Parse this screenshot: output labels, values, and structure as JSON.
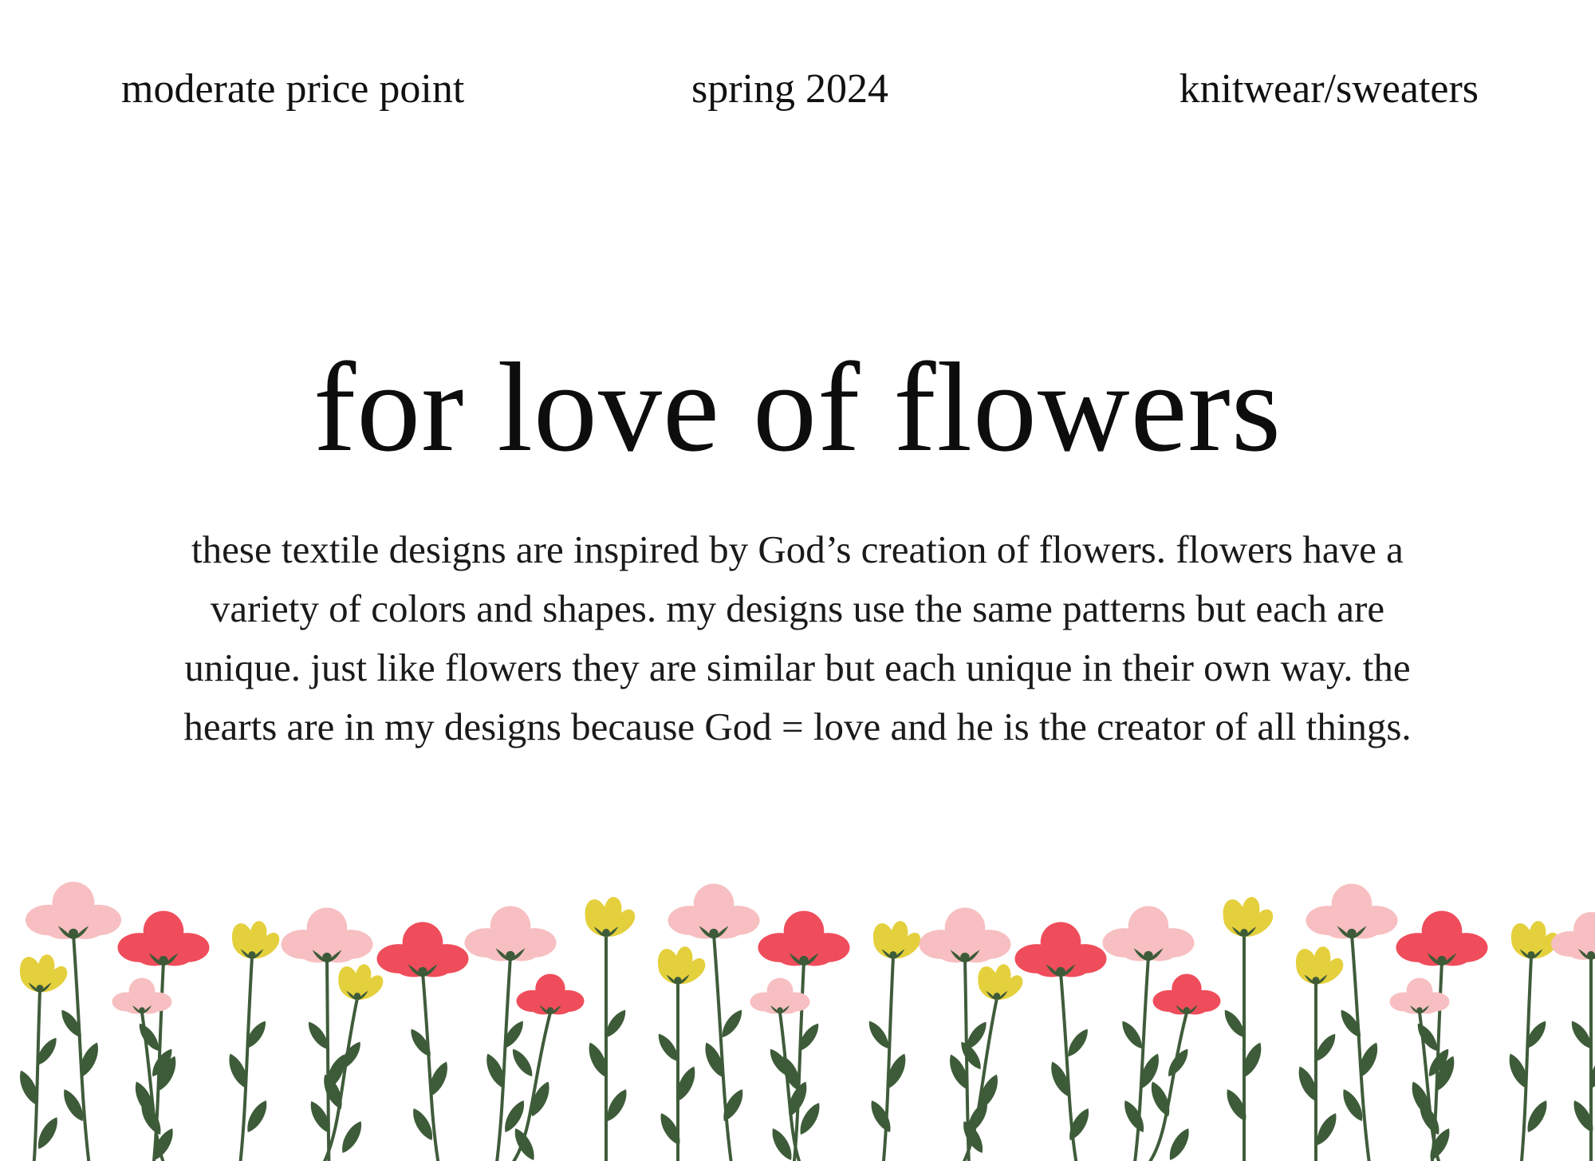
{
  "header": {
    "price_point": "moderate price point",
    "season": "spring 2024",
    "category": "knitwear/sweaters"
  },
  "main": {
    "title": "for love of flowers",
    "description": "these textile designs are inspired by God’s creation of flowers. flowers have a variety of colors and shapes. my designs use the same patterns but each are unique. just like flowers they are similar but each unique in their own way. the hearts are in my designs because God = love and he is the creator of all things."
  },
  "colors": {
    "text": "#111111",
    "background": "#ffffff",
    "stem": "#3f5c3a",
    "leaf": "#3d5b38",
    "petal_pink": "#f7bfc1",
    "petal_red": "#ef4d5b",
    "petal_yellow": "#e4d03d"
  },
  "decoration": {
    "icon": "flower-border-illustration"
  }
}
